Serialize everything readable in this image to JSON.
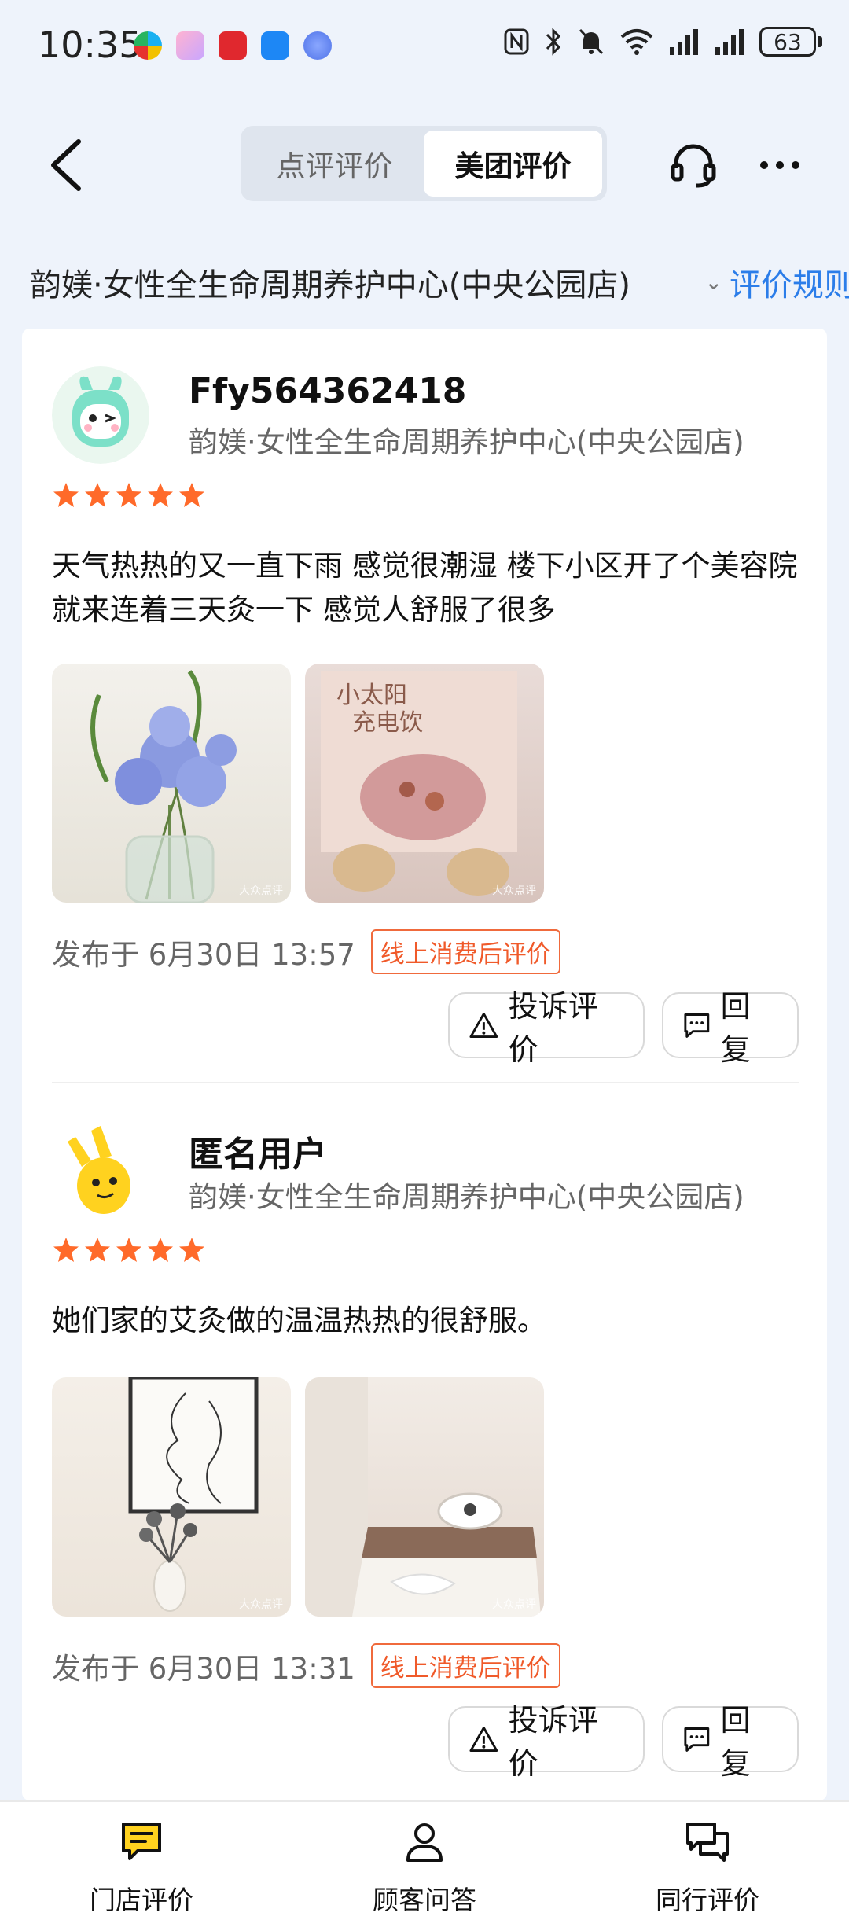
{
  "status_bar": {
    "time": "10:35",
    "battery": "63",
    "icons": [
      "nfc-icon",
      "bluetooth-icon",
      "mute-icon",
      "wifi-icon",
      "signal-icon",
      "signal-icon"
    ]
  },
  "nav": {
    "tabs": [
      {
        "label": "点评评价",
        "active": false
      },
      {
        "label": "美团评价",
        "active": true
      }
    ]
  },
  "shop": {
    "name": "韵媄·女性全生命周期养护中心(中央公园店)",
    "rules_link": "评价规则"
  },
  "reviews": [
    {
      "username": "Ffy564362418",
      "shop": "韵媄·女性全生命周期养护中心(中央公园店)",
      "rating": 5,
      "content": "天气热热的又一直下雨 感觉很潮湿 楼下小区开了个美容院 就来连着三天灸一下 感觉人舒服了很多",
      "date": "发布于 6月30日 13:57",
      "tag": "线上消费后评价"
    },
    {
      "username": "匿名用户",
      "shop": "韵媄·女性全生命周期养护中心(中央公园店)",
      "rating": 5,
      "content": "她们家的艾灸做的温温热热的很舒服。",
      "date": "发布于 6月30日 13:31",
      "tag": "线上消费后评价"
    }
  ],
  "actions": {
    "complain": "投诉评价",
    "reply": "回复"
  },
  "bottom_tabs": [
    {
      "label": "门店评价",
      "icon": "store-review-icon"
    },
    {
      "label": "顾客问答",
      "icon": "person-icon"
    },
    {
      "label": "同行评价",
      "icon": "chat-icon"
    }
  ],
  "colors": {
    "accent_blue": "#2b7de9",
    "star_orange": "#ff6a2a",
    "tag_orange": "#f05a2a",
    "active_tab_icon": "#ffd21f"
  }
}
